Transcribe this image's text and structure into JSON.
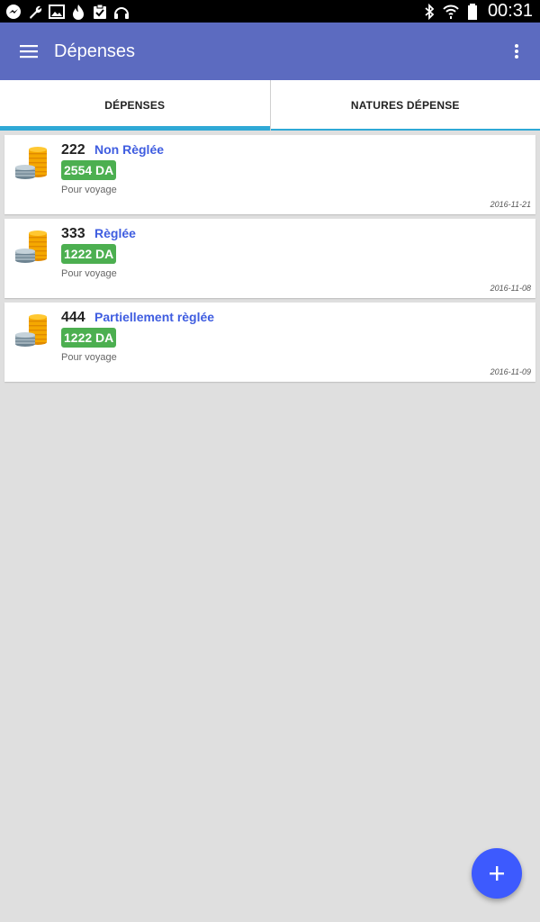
{
  "status_bar": {
    "time": "00:31",
    "left_icons": [
      "messenger-icon",
      "wrench-icon",
      "image-icon",
      "flame-icon",
      "clipboard-check-icon",
      "headphones-icon"
    ],
    "right_icons": [
      "bluetooth-icon",
      "wifi-icon",
      "battery-icon"
    ]
  },
  "app_bar": {
    "title": "Dépenses",
    "color": "#5c6bc0"
  },
  "tabs": [
    {
      "label": "DÉPENSES",
      "selected": true
    },
    {
      "label": "NATURES DÉPENSE",
      "selected": false
    }
  ],
  "expenses": [
    {
      "number": "222",
      "status": "Non Règlée",
      "amount": "2554 DA",
      "description": "Pour voyage",
      "date": "2016-11-21"
    },
    {
      "number": "333",
      "status": "Règlée",
      "amount": "1222 DA",
      "description": "Pour voyage",
      "date": "2016-11-08"
    },
    {
      "number": "444",
      "status": "Partiellement règlée",
      "amount": "1222 DA",
      "description": "Pour voyage",
      "date": "2016-11-09"
    }
  ],
  "colors": {
    "accent": "#3d5afe",
    "tab_indicator": "#2fa9d6",
    "amount_badge": "#4caf50",
    "status_text": "#3f5de0"
  },
  "fab": {
    "icon": "plus-icon"
  }
}
